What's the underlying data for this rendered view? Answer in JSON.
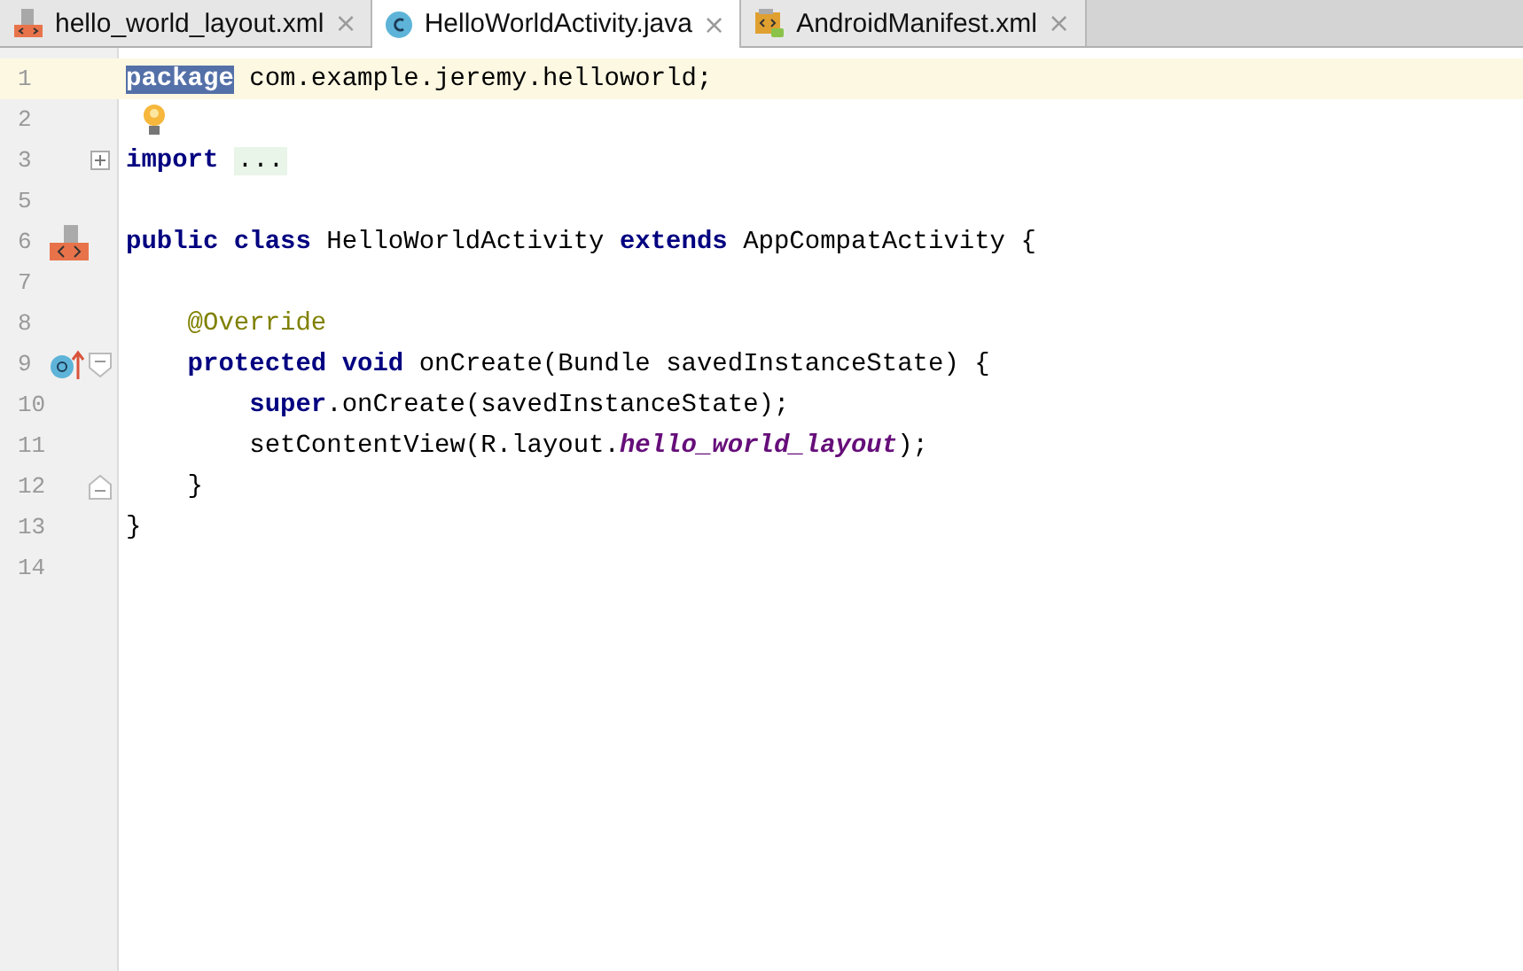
{
  "tabs": [
    {
      "label": "hello_world_layout.xml",
      "selected": false,
      "kind": "layout",
      "close": "×"
    },
    {
      "label": "HelloWorldActivity.java",
      "selected": true,
      "kind": "class",
      "close": "×"
    },
    {
      "label": "AndroidManifest.xml",
      "selected": false,
      "kind": "manifest",
      "close": "×"
    }
  ],
  "editor": {
    "lines": [
      {
        "number": "1",
        "current": true,
        "tokens": [
          {
            "text": "package",
            "kind": "selected-keyword"
          },
          {
            "text": " com.example.jeremy.helloworld;",
            "kind": "plain"
          }
        ]
      },
      {
        "number": "2",
        "current": false,
        "bulb": true
      },
      {
        "number": "3",
        "current": false,
        "fold": {
          "kind": "expand"
        },
        "tokens": [
          {
            "text": "import ",
            "kind": "keyword"
          },
          {
            "text": "...",
            "kind": "folded"
          }
        ]
      },
      {
        "number": "5",
        "current": false
      },
      {
        "number": "6",
        "current": false,
        "marker": {
          "kind": "layout"
        },
        "tokens": [
          {
            "text": "public class",
            "kind": "keyword"
          },
          {
            "text": " HelloWorldActivity ",
            "kind": "plain"
          },
          {
            "text": "extends",
            "kind": "keyword"
          },
          {
            "text": " AppCompatActivity {",
            "kind": "plain"
          }
        ]
      },
      {
        "number": "7",
        "current": false
      },
      {
        "number": "8",
        "current": false,
        "tokens": [
          {
            "text": "    @Override",
            "kind": "annotation"
          }
        ]
      },
      {
        "number": "9",
        "current": false,
        "marker": {
          "kind": "override"
        },
        "fold": {
          "kind": "start"
        },
        "tokens": [
          {
            "text": "    protected void",
            "kind": "keyword"
          },
          {
            "text": " onCreate(Bundle savedInstanceState) {",
            "kind": "plain"
          }
        ]
      },
      {
        "number": "10",
        "current": false,
        "tokens": [
          {
            "text": "        super",
            "kind": "keyword"
          },
          {
            "text": ".onCreate(savedInstanceState);",
            "kind": "plain"
          }
        ]
      },
      {
        "number": "11",
        "current": false,
        "tokens": [
          {
            "text": "        setContentView(R.layout.",
            "kind": "plain"
          },
          {
            "text": "hello_world_layout",
            "kind": "field"
          },
          {
            "text": ");",
            "kind": "plain"
          }
        ]
      },
      {
        "number": "12",
        "current": false,
        "fold": {
          "kind": "end"
        },
        "tokens": [
          {
            "text": "    }",
            "kind": "plain"
          }
        ]
      },
      {
        "number": "13",
        "current": false,
        "tokens": [
          {
            "text": "}",
            "kind": "plain"
          }
        ]
      },
      {
        "number": "14",
        "current": false
      }
    ]
  }
}
